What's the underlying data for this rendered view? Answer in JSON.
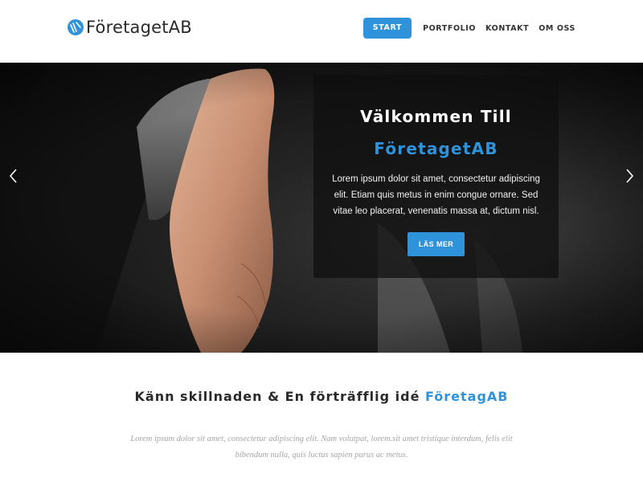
{
  "brand": {
    "name": "FöretagetAB",
    "accent_color": "#2f93dc",
    "logo_icon": "lines-circle-logo-icon"
  },
  "nav": {
    "items": [
      {
        "label": "START",
        "active": true
      },
      {
        "label": "PORTFOLIO",
        "active": false
      },
      {
        "label": "KONTAKT",
        "active": false
      },
      {
        "label": "OM OSS",
        "active": false
      }
    ]
  },
  "hero": {
    "title_line1": "Välkommen Till",
    "title_line2": "FöretagetAB",
    "text": "Lorem ipsum dolor sit amet, consectetur adipiscing elit. Etiam quis metus in enim congue ornare. Sed vitae leo placerat, venenatis massa at, dictum nisl.",
    "button_label": "LÄS MER",
    "prev_icon": "chevron-left-icon",
    "next_icon": "chevron-right-icon"
  },
  "section": {
    "heading_prefix": "Känn skillnaden & En förträfflig idé ",
    "heading_accent": "FöretagAB",
    "text": "Lorem ipsum dolor sit amet, consectetur adipiscing elit. Nam volutpat, lorem.sit amet tristique interdum, felis elit bibendum nulla, quis luctus sapien purus ac metus."
  }
}
